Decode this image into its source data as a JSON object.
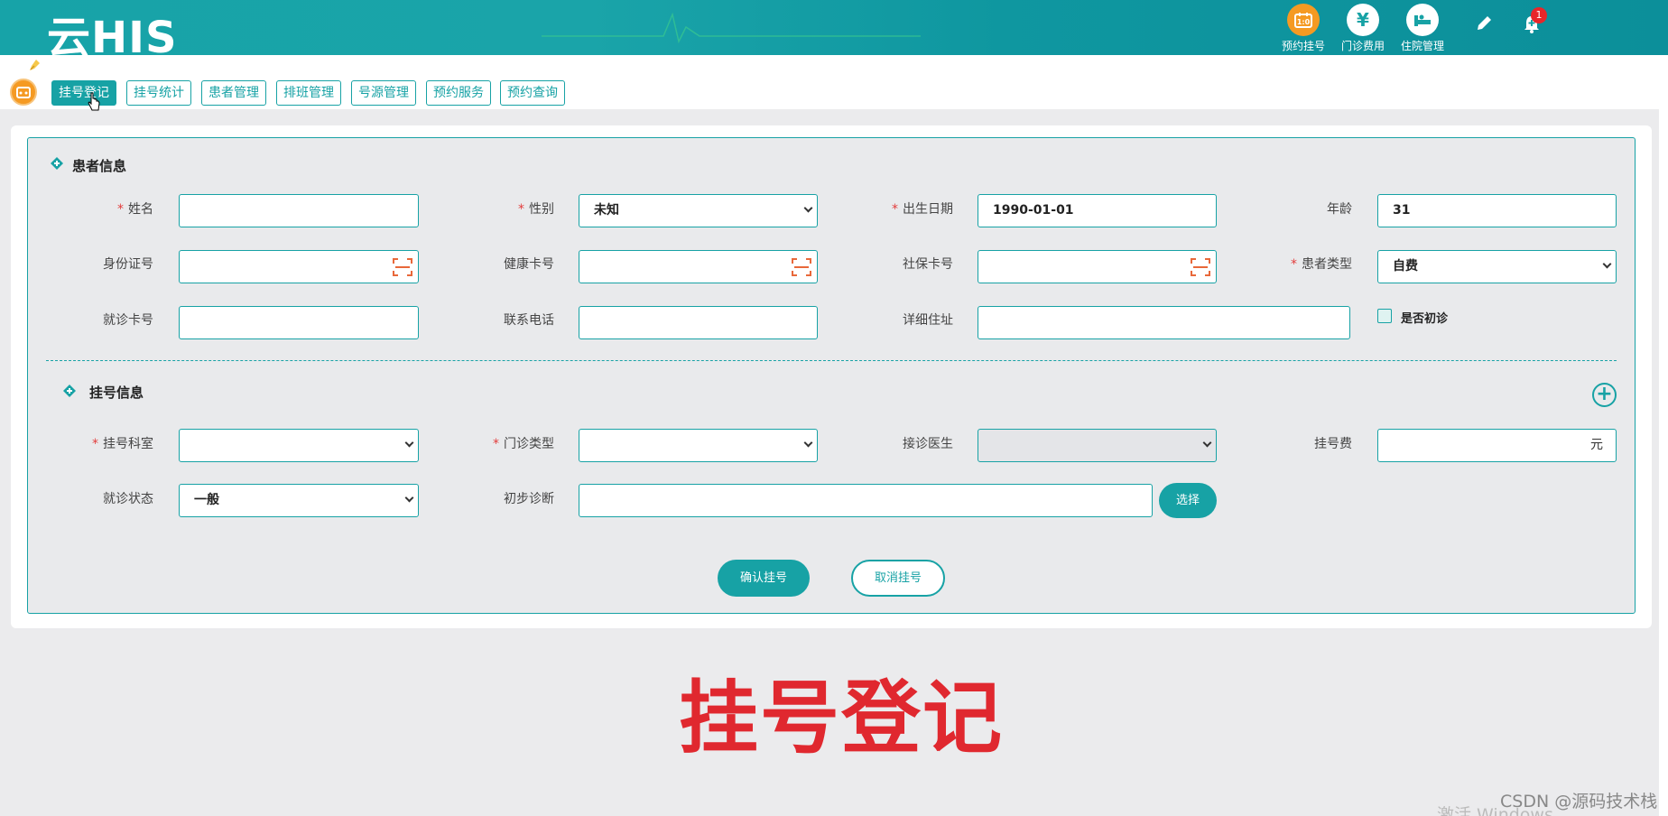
{
  "header": {
    "logo": "云HIS",
    "buttons": [
      {
        "label": "预约挂号",
        "icon": "calendar-icon",
        "color": "#f59a23"
      },
      {
        "label": "门诊费用",
        "icon": "yen-icon",
        "color": "#ffffff"
      },
      {
        "label": "住院管理",
        "icon": "bed-icon",
        "color": "#ffffff"
      }
    ],
    "notification_count": "1"
  },
  "tabs": [
    "挂号登记",
    "挂号统计",
    "患者管理",
    "排班管理",
    "号源管理",
    "预约服务",
    "预约查询"
  ],
  "patient_section": {
    "title": "患者信息",
    "name_label": "姓名",
    "gender_label": "性别",
    "gender_value": "未知",
    "birth_label": "出生日期",
    "birth_value": "1990-01-01",
    "age_label": "年龄",
    "age_value": "31",
    "id_label": "身份证号",
    "health_card_label": "健康卡号",
    "social_card_label": "社保卡号",
    "patient_type_label": "患者类型",
    "patient_type_value": "自费",
    "visit_card_label": "就诊卡号",
    "phone_label": "联系电话",
    "address_label": "详细住址",
    "first_visit_label": "是否初诊"
  },
  "registration_section": {
    "title": "挂号信息",
    "dept_label": "挂号科室",
    "clinic_type_label": "门诊类型",
    "doctor_label": "接诊医生",
    "fee_label": "挂号费",
    "fee_unit": "元",
    "visit_status_label": "就诊状态",
    "visit_status_value": "一般",
    "diagnosis_label": "初步诊断",
    "select_button": "选择"
  },
  "actions": {
    "confirm": "确认挂号",
    "cancel": "取消挂号"
  },
  "caption": "挂号登记",
  "watermark": "CSDN @源码技术栈",
  "os_watermark": "激活 Windows",
  "colors": {
    "accent": "#17a2a5",
    "required": "#e23c3c",
    "caption": "#e0282f"
  }
}
